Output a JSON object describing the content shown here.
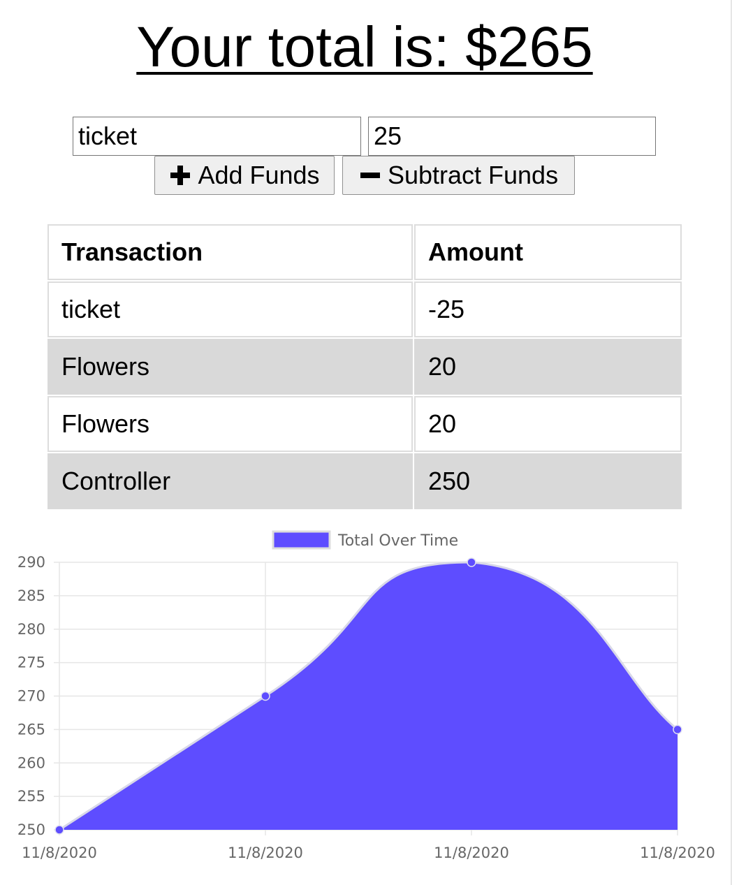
{
  "header": {
    "total_text": "Your total is: $265"
  },
  "form": {
    "name_value": "ticket",
    "amount_value": "25",
    "add_label": "Add Funds",
    "subtract_label": "Subtract Funds",
    "add_icon": "plus-icon",
    "subtract_icon": "minus-icon"
  },
  "table": {
    "headers": [
      "Transaction",
      "Amount"
    ],
    "rows": [
      {
        "name": "ticket",
        "amount": "-25"
      },
      {
        "name": "Flowers",
        "amount": "20"
      },
      {
        "name": "Flowers",
        "amount": "20"
      },
      {
        "name": "Controller",
        "amount": "250"
      }
    ]
  },
  "colors": {
    "series_fill": "#5e4dff",
    "row_shade": "#d9d9d9"
  },
  "chart_data": {
    "type": "area",
    "legend": "Total Over Time",
    "legend_position": "top",
    "x": [
      "11/8/2020",
      "11/8/2020",
      "11/8/2020",
      "11/8/2020"
    ],
    "series": [
      {
        "name": "Total Over Time",
        "values": [
          250,
          270,
          290,
          265
        ]
      }
    ],
    "y_ticks": [
      250,
      255,
      260,
      265,
      270,
      275,
      280,
      285,
      290
    ],
    "ylim": [
      250,
      290
    ],
    "grid": true
  }
}
